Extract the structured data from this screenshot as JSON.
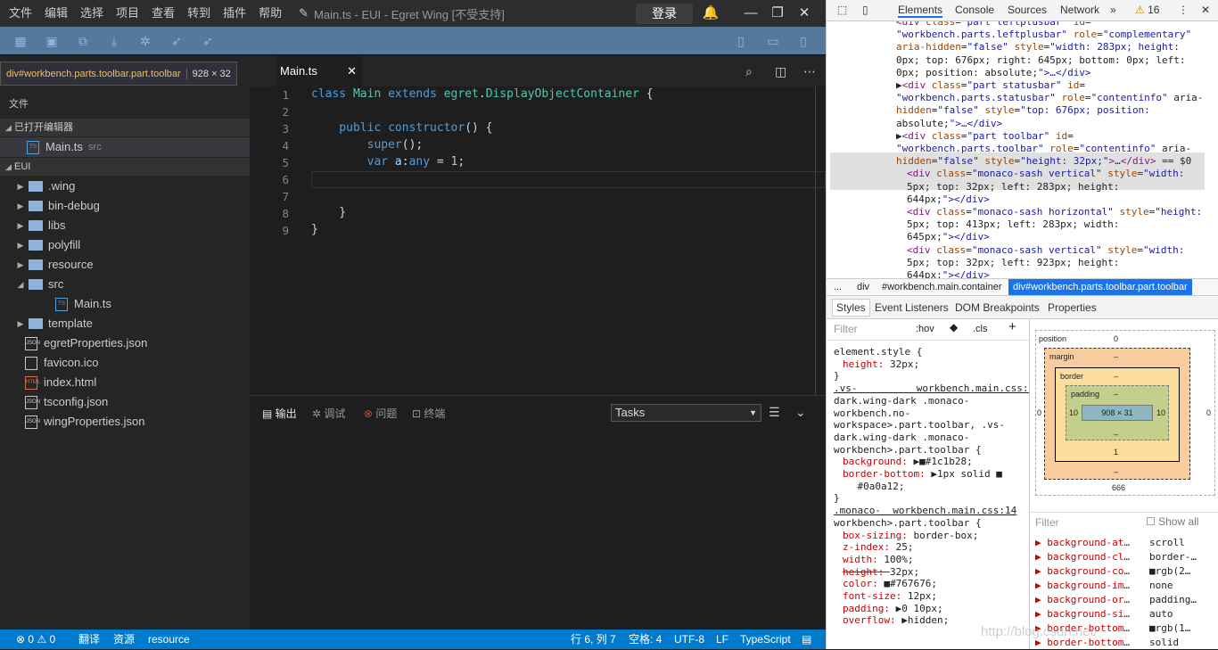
{
  "ide": {
    "menu": [
      "文件",
      "编辑",
      "选择",
      "项目",
      "查看",
      "转到",
      "插件",
      "帮助"
    ],
    "window_title": "Main.ts - EUI - Egret Wing [不受支持]",
    "login_label": "登录",
    "tooltip": {
      "selector": "div#workbench.parts.toolbar.part.toolbar",
      "size": "928 × 32"
    },
    "sidebar": {
      "header": "文件",
      "open_editors_label": "已打开编辑器",
      "open_file": {
        "name": "Main.ts",
        "hint": "src"
      },
      "project_label": "EUI",
      "tree": [
        {
          "name": ".wing",
          "kind": "folder"
        },
        {
          "name": "bin-debug",
          "kind": "folder"
        },
        {
          "name": "libs",
          "kind": "folder"
        },
        {
          "name": "polyfill",
          "kind": "folder"
        },
        {
          "name": "resource",
          "kind": "folder"
        },
        {
          "name": "src",
          "kind": "folder-open"
        },
        {
          "name": "Main.ts",
          "kind": "ts"
        },
        {
          "name": "template",
          "kind": "folder"
        },
        {
          "name": "egretProperties.json",
          "kind": "json"
        },
        {
          "name": "favicon.ico",
          "kind": "ico"
        },
        {
          "name": "index.html",
          "kind": "html"
        },
        {
          "name": "tsconfig.json",
          "kind": "json"
        },
        {
          "name": "wingProperties.json",
          "kind": "json"
        }
      ]
    },
    "tab": {
      "label": "Main.ts"
    },
    "line_numbers": [
      "1",
      "2",
      "3",
      "4",
      "5",
      "6",
      "7",
      "8",
      "9"
    ],
    "code": [
      [
        {
          "c": "kw",
          "t": "class "
        },
        {
          "c": "cl",
          "t": "Main "
        },
        {
          "c": "kw",
          "t": "extends "
        },
        {
          "c": "cl",
          "t": "egret"
        },
        {
          "c": "pl",
          "t": "."
        },
        {
          "c": "cl",
          "t": "DisplayObjectContainer"
        },
        {
          "c": "pl",
          "t": " {"
        }
      ],
      [],
      [
        {
          "c": "kw",
          "t": "    public "
        },
        {
          "c": "kw",
          "t": "constructor"
        },
        {
          "c": "pl",
          "t": "() {"
        }
      ],
      [
        {
          "c": "kw",
          "t": "        super"
        },
        {
          "c": "pl",
          "t": "();"
        }
      ],
      [
        {
          "c": "kw",
          "t": "        var "
        },
        {
          "c": "vr",
          "t": "a"
        },
        {
          "c": "pl",
          "t": ":"
        },
        {
          "c": "kw",
          "t": "any"
        },
        {
          "c": "pl",
          "t": " = "
        },
        {
          "c": "nm",
          "t": "1"
        },
        {
          "c": "pl",
          "t": ";"
        }
      ],
      [],
      [],
      [
        {
          "c": "pl",
          "t": "    }"
        }
      ],
      [
        {
          "c": "pl",
          "t": "}"
        }
      ]
    ],
    "panel_tabs": [
      "输出",
      "调试",
      "问题",
      "终端"
    ],
    "tasks_value": "Tasks",
    "status": {
      "errors": "0",
      "warnings": "0",
      "compile": "翻译",
      "resources": "资源",
      "folder": "resource",
      "position": "行 6, 列 7",
      "spaces": "空格: 4",
      "encoding": "UTF-8",
      "eol": "LF",
      "lang": "TypeScript"
    }
  },
  "devtools": {
    "tabs": [
      "Elements",
      "Console",
      "Sources",
      "Network"
    ],
    "warn_count": "16",
    "dom_lines": [
      {
        "indent": 0,
        "html": "<div class=\"part leftplusbar\" id="
      },
      {
        "indent": 0,
        "html": "\"workbench.parts.leftplusbar\" role=\"complementary\""
      },
      {
        "indent": 0,
        "html": "aria-hidden=\"false\" style=\"width: 283px; height:"
      },
      {
        "indent": 0,
        "html": "0px; top: 676px; right: 645px; bottom: 0px; left:"
      },
      {
        "indent": 0,
        "html": "0px; position: absolute;\">…</div>"
      },
      {
        "indent": 0,
        "html": "▶<div class=\"part statusbar\" id="
      },
      {
        "indent": 0,
        "html": "\"workbench.parts.statusbar\" role=\"contentinfo\" aria-"
      },
      {
        "indent": 0,
        "html": "hidden=\"false\" style=\"top: 676px; position:"
      },
      {
        "indent": 0,
        "html": "absolute;\">…</div>"
      },
      {
        "indent": 0,
        "html": "▶<div class=\"part toolbar\" id="
      },
      {
        "indent": 0,
        "html": "\"workbench.parts.toolbar\" role=\"contentinfo\" aria-"
      },
      {
        "indent": 0,
        "html": "hidden=\"false\" style=\"height: 32px;\">…</div> == $0"
      },
      {
        "indent": 1,
        "html": "<div class=\"monaco-sash vertical\" style=\"width:"
      },
      {
        "indent": 1,
        "html": "5px; top: 32px; left: 283px; height:"
      },
      {
        "indent": 1,
        "html": "644px;\"></div>"
      },
      {
        "indent": 1,
        "html": "<div class=\"monaco-sash horizontal\" style=\"height:"
      },
      {
        "indent": 1,
        "html": "5px; top: 413px; left: 283px; width:"
      },
      {
        "indent": 1,
        "html": "645px;\"></div>"
      },
      {
        "indent": 1,
        "html": "<div class=\"monaco-sash vertical\" style=\"width:"
      },
      {
        "indent": 1,
        "html": "5px; top: 32px; left: 923px; height:"
      },
      {
        "indent": 1,
        "html": "644px;\"></div>"
      }
    ],
    "breadcrumb": [
      "...",
      "div",
      "#workbench.main.container",
      "div#workbench.parts.toolbar.part.toolbar"
    ],
    "subtabs": [
      "Styles",
      "Event Listeners",
      "DOM Breakpoints",
      "Properties"
    ],
    "filter_placeholder": "Filter",
    "hov": ":hov",
    "cls": ".cls",
    "style_lines": [
      {
        "k": "sel",
        "t": "element.style {"
      },
      {
        "k": "prop",
        "n": "height",
        "v": "32px;"
      },
      {
        "k": "sel",
        "t": "}"
      },
      {
        "k": "link",
        "t": ".vs-          workbench.main.css:14"
      },
      {
        "k": "sel",
        "t": "dark.wing-dark .monaco-"
      },
      {
        "k": "sel",
        "t": "workbench.no-"
      },
      {
        "k": "sel",
        "t": "workspace>.part.toolbar, .vs-"
      },
      {
        "k": "sel",
        "t": "dark.wing-dark .monaco-"
      },
      {
        "k": "sel",
        "t": "workbench>.part.toolbar {"
      },
      {
        "k": "prop",
        "n": "background",
        "v": "▶■#1c1b28;"
      },
      {
        "k": "prop",
        "n": "border-bottom",
        "v": "▶1px solid ■"
      },
      {
        "k": "sel",
        "t": "    #0a0a12;"
      },
      {
        "k": "sel",
        "t": "}"
      },
      {
        "k": "link",
        "t": ".monaco-  workbench.main.css:14"
      },
      {
        "k": "sel",
        "t": "workbench>.part.toolbar {"
      },
      {
        "k": "prop",
        "n": "box-sizing",
        "v": "border-box;"
      },
      {
        "k": "prop",
        "n": "z-index",
        "v": "25;"
      },
      {
        "k": "prop",
        "n": "width",
        "v": "100%;"
      },
      {
        "k": "prop",
        "n": "height",
        "v": "32px;"
      },
      {
        "k": "prop",
        "n": "color",
        "v": "■#767676;"
      },
      {
        "k": "prop",
        "n": "font-size",
        "v": "12px;"
      },
      {
        "k": "prop",
        "n": "padding",
        "v": "▶0 10px;"
      },
      {
        "k": "prop",
        "n": "overflow",
        "v": "▶hidden;"
      }
    ],
    "box": {
      "position": "position",
      "pos_val": "0",
      "margin": "margin",
      "dash": "–",
      "border": "border",
      "padding": "padding",
      "content": "908 × 31",
      "pad_lr": "10",
      "border_bottom": "1",
      "outer": "666",
      "side0": "0"
    },
    "computed_filter": "Filter",
    "show_all": "Show all",
    "computed": [
      {
        "n": "background-at…",
        "v": "scroll"
      },
      {
        "n": "background-cl…",
        "v": "border-…"
      },
      {
        "n": "background-co…",
        "v": "■rgb(2…"
      },
      {
        "n": "background-im…",
        "v": "none"
      },
      {
        "n": "background-or…",
        "v": "padding…"
      },
      {
        "n": "background-si…",
        "v": "auto"
      },
      {
        "n": "border-bottom…",
        "v": "■rgb(1…"
      },
      {
        "n": "border-bottom…",
        "v": "solid"
      }
    ],
    "watermark": "http://blog.csdn.net/"
  }
}
